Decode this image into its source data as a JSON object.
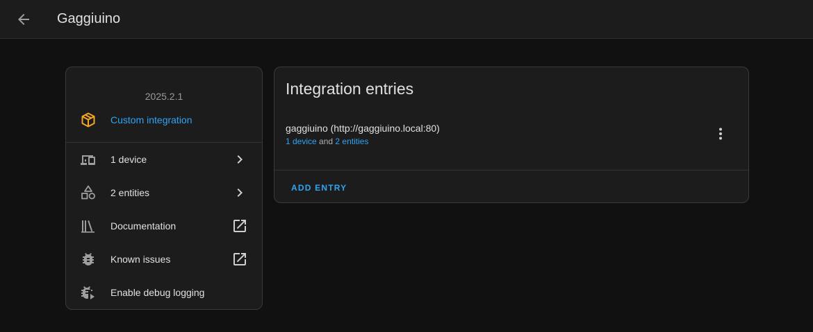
{
  "header": {
    "title": "Gaggiuino"
  },
  "info": {
    "version": "2025.2.1",
    "custom_label": "Custom integration",
    "items": [
      {
        "label": "1 device",
        "icon": "devices-icon",
        "trailing": "chevron-right-icon"
      },
      {
        "label": "2 entities",
        "icon": "shapes-icon",
        "trailing": "chevron-right-icon"
      },
      {
        "label": "Documentation",
        "icon": "book-icon",
        "trailing": "open-in-new-icon"
      },
      {
        "label": "Known issues",
        "icon": "bug-icon",
        "trailing": "open-in-new-icon"
      },
      {
        "label": "Enable debug logging",
        "icon": "bug-play-icon",
        "trailing": ""
      }
    ]
  },
  "entries": {
    "title": "Integration entries",
    "entry": {
      "name": "gaggiuino (http://gaggiuino.local:80)",
      "devices_link": "1 device",
      "and_text": "and",
      "entities_link": "2 entities"
    },
    "add_label": "ADD ENTRY"
  },
  "colors": {
    "accent": "#2fa4f2",
    "custom_icon": "#f5a623",
    "background": "#111111",
    "card": "#1c1c1c"
  }
}
